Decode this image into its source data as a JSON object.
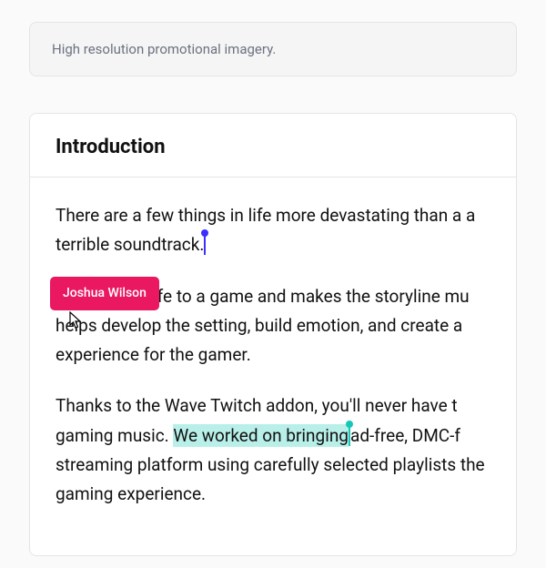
{
  "topCard": {
    "caption": "High resolution promotional imagery."
  },
  "document": {
    "title": "Introduction",
    "paragraphs": {
      "p1_a": "There are a few things in life more devastating than a ",
      "p1_b": "a terrible soundtrack.",
      "p2_a": "",
      "p2_b": " life to a game and makes the storyline mu",
      "p2_c": " helps develop the setting, build emotion, and create a ",
      "p2_d": "experience for the gamer.",
      "p3_a": "Thanks to the Wave Twitch addon, you'll never have t",
      "p3_b": " gaming music. ",
      "p3_highlight": "We worked on bringing",
      "p3_c": "ad-free, DMC-f",
      "p3_d": " streaming platform using carefully selected playlists ",
      "p3_e": "the gaming experience."
    }
  },
  "collaborator": {
    "name": "Joshua Wilson",
    "tagColor": "#e91860"
  },
  "colors": {
    "cursorBlue": "#3b2fff",
    "cursorTeal": "#14c7b8",
    "highlightTeal": "#b9efe9"
  }
}
